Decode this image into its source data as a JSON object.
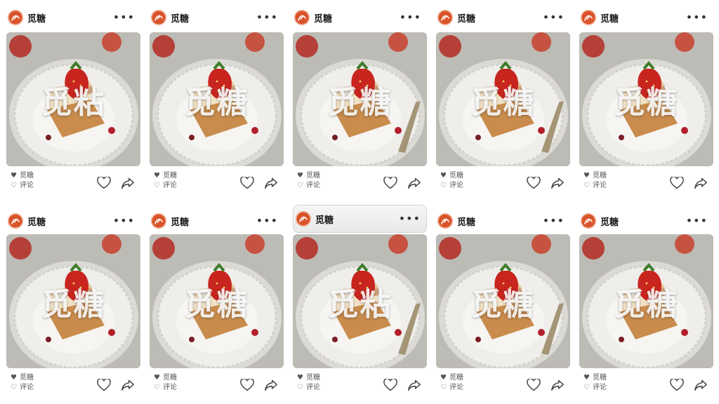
{
  "posts": [
    {
      "brand": "觅糖",
      "watermark": "觅粘",
      "likes_label": "觅糖",
      "comment_label": "评论"
    },
    {
      "brand": "觅糖",
      "watermark": "觅糖",
      "likes_label": "觅糖",
      "comment_label": "评论"
    },
    {
      "brand": "觅糖",
      "watermark": "觅糖",
      "likes_label": "觅糖",
      "comment_label": "评论"
    },
    {
      "brand": "觅糖",
      "watermark": "觅糖",
      "likes_label": "觅糖",
      "comment_label": "评论"
    },
    {
      "brand": "觅糖",
      "watermark": "觅糖",
      "likes_label": "觅糖",
      "comment_label": "评论"
    },
    {
      "brand": "觅糖",
      "watermark": "觅糖",
      "likes_label": "觅糖",
      "comment_label": "评论"
    },
    {
      "brand": "觅糖",
      "watermark": "觅糖",
      "likes_label": "觅糖",
      "comment_label": "评论"
    },
    {
      "brand": "觅糖",
      "watermark": "觅粘",
      "likes_label": "觅糖",
      "comment_label": "评论"
    },
    {
      "brand": "觅糖",
      "watermark": "觅糖",
      "likes_label": "觅糖",
      "comment_label": "评论"
    },
    {
      "brand": "觅糖",
      "watermark": "觅糖",
      "likes_label": "觅糖",
      "comment_label": "评论"
    }
  ],
  "icons": {
    "more": "more-dots-icon",
    "heart": "heart-icon",
    "share": "share-icon",
    "avatar": "brand-logo-icon"
  },
  "colors": {
    "brand": "#d9542a",
    "plate": "#ecebe8",
    "strawberry": "#c9251f",
    "cake": "#d9b98a"
  },
  "highlighted_card_index": 7
}
